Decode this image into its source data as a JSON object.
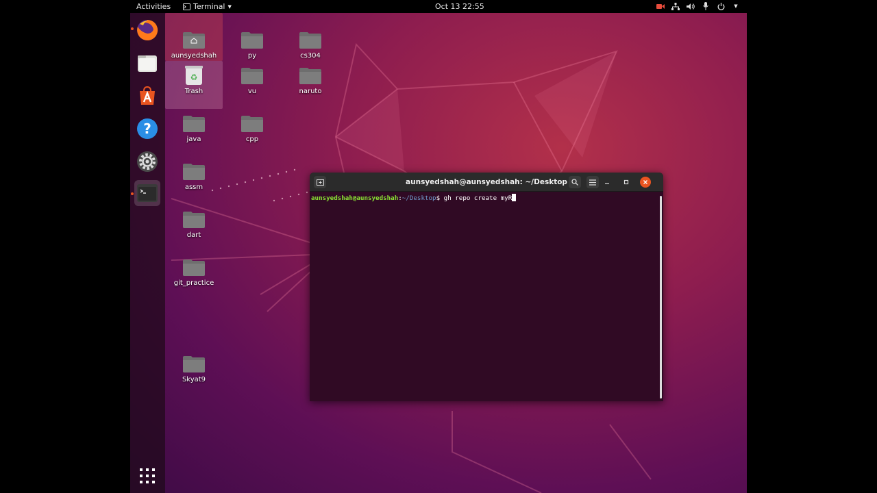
{
  "topbar": {
    "activities": "Activities",
    "app_name": "Terminal",
    "clock": "Oct 13  22:55"
  },
  "dock": {
    "items": [
      {
        "name": "firefox",
        "icon": "firefox-icon"
      },
      {
        "name": "files",
        "icon": "files-icon"
      },
      {
        "name": "software",
        "icon": "ubuntu-software-icon"
      },
      {
        "name": "help",
        "icon": "help-icon"
      },
      {
        "name": "settings",
        "icon": "settings-icon"
      },
      {
        "name": "terminal",
        "icon": "terminal-icon"
      },
      {
        "name": "show-apps",
        "icon": "app-grid-icon"
      }
    ],
    "accent": "#e95420"
  },
  "desktop": {
    "icons": [
      {
        "label": "aunsyedshah",
        "icon": "home-folder-icon"
      },
      {
        "label": "py",
        "icon": "folder-icon"
      },
      {
        "label": "cs304",
        "icon": "folder-icon"
      },
      {
        "label": "Trash",
        "icon": "trash-icon"
      },
      {
        "label": "vu",
        "icon": "folder-icon"
      },
      {
        "label": "naruto",
        "icon": "folder-icon"
      },
      {
        "label": "java",
        "icon": "folder-icon"
      },
      {
        "label": "cpp",
        "icon": "folder-icon"
      },
      {
        "label": "assm",
        "icon": "folder-icon"
      },
      {
        "label": "dart",
        "icon": "folder-icon"
      },
      {
        "label": "git_practice",
        "icon": "folder-icon"
      },
      {
        "label": "Skyat9",
        "icon": "folder-icon"
      }
    ]
  },
  "terminal": {
    "title": "aunsyedshah@aunsyedshah: ~/Desktop",
    "prompt_user": "aunsyedshah@aunsyedshah",
    "prompt_sep": ":",
    "prompt_path": "~/Desktop",
    "prompt_symbol": "$ ",
    "command": "gh repo create myR",
    "colors": {
      "background": "#300a24",
      "user": "#8ae234",
      "path": "#729fcf",
      "close": "#e95420"
    }
  }
}
